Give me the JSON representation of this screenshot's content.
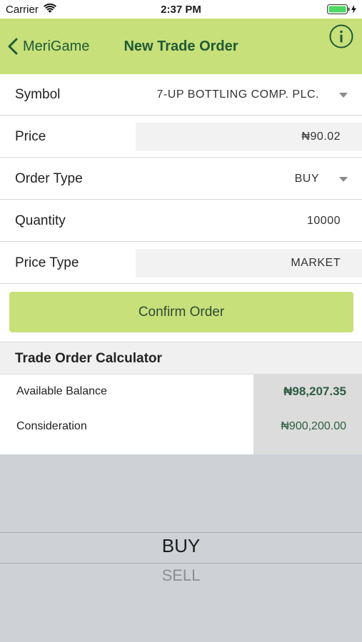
{
  "status_bar": {
    "carrier": "Carrier",
    "time": "2:37 PM"
  },
  "nav": {
    "back_label": "MeriGame",
    "title": "New Trade Order",
    "info_icon": "info-icon"
  },
  "form": {
    "symbol": {
      "label": "Symbol",
      "value": "7-UP BOTTLING COMP. PLC."
    },
    "price": {
      "label": "Price",
      "value": "₦90.02"
    },
    "order_type": {
      "label": "Order Type",
      "value": "BUY"
    },
    "quantity": {
      "label": "Quantity",
      "value": "10000"
    },
    "price_type": {
      "label": "Price Type",
      "value": "MARKET"
    }
  },
  "confirm_label": "Confirm Order",
  "calculator": {
    "title": "Trade Order Calculator",
    "rows": [
      {
        "label": "Available Balance",
        "value": "₦98,207.35"
      },
      {
        "label": "Consideration",
        "value": "₦900,200.00"
      }
    ]
  },
  "picker": {
    "options": [
      "BUY",
      "SELL"
    ],
    "selected": "BUY"
  },
  "colors": {
    "accent": "#c8e07a",
    "nav_text": "#1f5a36",
    "value_green": "#2e5e42",
    "picker_bg": "#ced2d7"
  }
}
